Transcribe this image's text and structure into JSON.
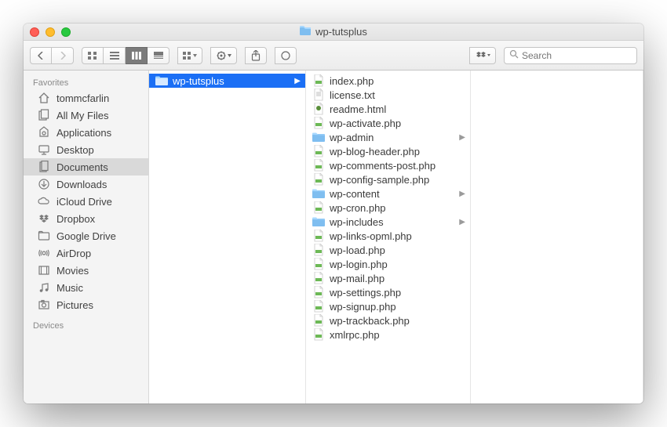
{
  "window": {
    "title": "wp-tutsplus"
  },
  "search": {
    "placeholder": "Search"
  },
  "sidebar": {
    "sections": [
      {
        "header": "Favorites",
        "items": [
          {
            "icon": "home-icon",
            "label": "tommcfarlin"
          },
          {
            "icon": "allfiles-icon",
            "label": "All My Files"
          },
          {
            "icon": "apps-icon",
            "label": "Applications"
          },
          {
            "icon": "desktop-icon",
            "label": "Desktop"
          },
          {
            "icon": "documents-icon",
            "label": "Documents",
            "selected": true
          },
          {
            "icon": "downloads-icon",
            "label": "Downloads"
          },
          {
            "icon": "icloud-icon",
            "label": "iCloud Drive"
          },
          {
            "icon": "dropbox-icon",
            "label": "Dropbox"
          },
          {
            "icon": "folder-icon",
            "label": "Google Drive"
          },
          {
            "icon": "airdrop-icon",
            "label": "AirDrop"
          },
          {
            "icon": "movies-icon",
            "label": "Movies"
          },
          {
            "icon": "music-icon",
            "label": "Music"
          },
          {
            "icon": "pictures-icon",
            "label": "Pictures"
          }
        ]
      },
      {
        "header": "Devices",
        "items": []
      }
    ]
  },
  "columns": [
    {
      "items": [
        {
          "type": "folder",
          "name": "wp-tutsplus",
          "selected": true,
          "hasChildren": true
        }
      ]
    },
    {
      "items": [
        {
          "type": "php",
          "name": "index.php"
        },
        {
          "type": "txt",
          "name": "license.txt"
        },
        {
          "type": "html",
          "name": "readme.html"
        },
        {
          "type": "php",
          "name": "wp-activate.php"
        },
        {
          "type": "folder",
          "name": "wp-admin",
          "hasChildren": true
        },
        {
          "type": "php",
          "name": "wp-blog-header.php"
        },
        {
          "type": "php",
          "name": "wp-comments-post.php"
        },
        {
          "type": "php",
          "name": "wp-config-sample.php"
        },
        {
          "type": "folder",
          "name": "wp-content",
          "hasChildren": true
        },
        {
          "type": "php",
          "name": "wp-cron.php"
        },
        {
          "type": "folder",
          "name": "wp-includes",
          "hasChildren": true
        },
        {
          "type": "php",
          "name": "wp-links-opml.php"
        },
        {
          "type": "php",
          "name": "wp-load.php"
        },
        {
          "type": "php",
          "name": "wp-login.php"
        },
        {
          "type": "php",
          "name": "wp-mail.php"
        },
        {
          "type": "php",
          "name": "wp-settings.php"
        },
        {
          "type": "php",
          "name": "wp-signup.php"
        },
        {
          "type": "php",
          "name": "wp-trackback.php"
        },
        {
          "type": "php",
          "name": "xmlrpc.php"
        }
      ]
    }
  ]
}
